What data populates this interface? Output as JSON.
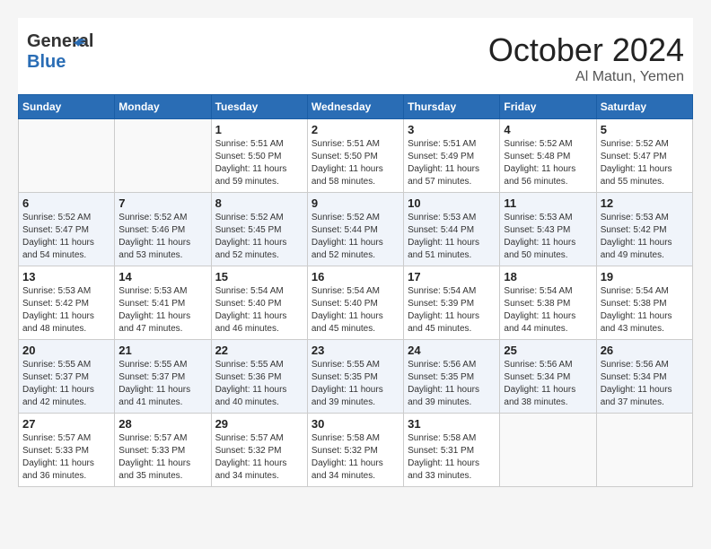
{
  "header": {
    "logo_general": "General",
    "logo_blue": "Blue",
    "month": "October 2024",
    "location": "Al Matun, Yemen"
  },
  "days_of_week": [
    "Sunday",
    "Monday",
    "Tuesday",
    "Wednesday",
    "Thursday",
    "Friday",
    "Saturday"
  ],
  "weeks": [
    [
      {
        "day": "",
        "sunrise": "",
        "sunset": "",
        "daylight": ""
      },
      {
        "day": "",
        "sunrise": "",
        "sunset": "",
        "daylight": ""
      },
      {
        "day": "1",
        "sunrise": "Sunrise: 5:51 AM",
        "sunset": "Sunset: 5:50 PM",
        "daylight": "Daylight: 11 hours and 59 minutes."
      },
      {
        "day": "2",
        "sunrise": "Sunrise: 5:51 AM",
        "sunset": "Sunset: 5:50 PM",
        "daylight": "Daylight: 11 hours and 58 minutes."
      },
      {
        "day": "3",
        "sunrise": "Sunrise: 5:51 AM",
        "sunset": "Sunset: 5:49 PM",
        "daylight": "Daylight: 11 hours and 57 minutes."
      },
      {
        "day": "4",
        "sunrise": "Sunrise: 5:52 AM",
        "sunset": "Sunset: 5:48 PM",
        "daylight": "Daylight: 11 hours and 56 minutes."
      },
      {
        "day": "5",
        "sunrise": "Sunrise: 5:52 AM",
        "sunset": "Sunset: 5:47 PM",
        "daylight": "Daylight: 11 hours and 55 minutes."
      }
    ],
    [
      {
        "day": "6",
        "sunrise": "Sunrise: 5:52 AM",
        "sunset": "Sunset: 5:47 PM",
        "daylight": "Daylight: 11 hours and 54 minutes."
      },
      {
        "day": "7",
        "sunrise": "Sunrise: 5:52 AM",
        "sunset": "Sunset: 5:46 PM",
        "daylight": "Daylight: 11 hours and 53 minutes."
      },
      {
        "day": "8",
        "sunrise": "Sunrise: 5:52 AM",
        "sunset": "Sunset: 5:45 PM",
        "daylight": "Daylight: 11 hours and 52 minutes."
      },
      {
        "day": "9",
        "sunrise": "Sunrise: 5:52 AM",
        "sunset": "Sunset: 5:44 PM",
        "daylight": "Daylight: 11 hours and 52 minutes."
      },
      {
        "day": "10",
        "sunrise": "Sunrise: 5:53 AM",
        "sunset": "Sunset: 5:44 PM",
        "daylight": "Daylight: 11 hours and 51 minutes."
      },
      {
        "day": "11",
        "sunrise": "Sunrise: 5:53 AM",
        "sunset": "Sunset: 5:43 PM",
        "daylight": "Daylight: 11 hours and 50 minutes."
      },
      {
        "day": "12",
        "sunrise": "Sunrise: 5:53 AM",
        "sunset": "Sunset: 5:42 PM",
        "daylight": "Daylight: 11 hours and 49 minutes."
      }
    ],
    [
      {
        "day": "13",
        "sunrise": "Sunrise: 5:53 AM",
        "sunset": "Sunset: 5:42 PM",
        "daylight": "Daylight: 11 hours and 48 minutes."
      },
      {
        "day": "14",
        "sunrise": "Sunrise: 5:53 AM",
        "sunset": "Sunset: 5:41 PM",
        "daylight": "Daylight: 11 hours and 47 minutes."
      },
      {
        "day": "15",
        "sunrise": "Sunrise: 5:54 AM",
        "sunset": "Sunset: 5:40 PM",
        "daylight": "Daylight: 11 hours and 46 minutes."
      },
      {
        "day": "16",
        "sunrise": "Sunrise: 5:54 AM",
        "sunset": "Sunset: 5:40 PM",
        "daylight": "Daylight: 11 hours and 45 minutes."
      },
      {
        "day": "17",
        "sunrise": "Sunrise: 5:54 AM",
        "sunset": "Sunset: 5:39 PM",
        "daylight": "Daylight: 11 hours and 45 minutes."
      },
      {
        "day": "18",
        "sunrise": "Sunrise: 5:54 AM",
        "sunset": "Sunset: 5:38 PM",
        "daylight": "Daylight: 11 hours and 44 minutes."
      },
      {
        "day": "19",
        "sunrise": "Sunrise: 5:54 AM",
        "sunset": "Sunset: 5:38 PM",
        "daylight": "Daylight: 11 hours and 43 minutes."
      }
    ],
    [
      {
        "day": "20",
        "sunrise": "Sunrise: 5:55 AM",
        "sunset": "Sunset: 5:37 PM",
        "daylight": "Daylight: 11 hours and 42 minutes."
      },
      {
        "day": "21",
        "sunrise": "Sunrise: 5:55 AM",
        "sunset": "Sunset: 5:37 PM",
        "daylight": "Daylight: 11 hours and 41 minutes."
      },
      {
        "day": "22",
        "sunrise": "Sunrise: 5:55 AM",
        "sunset": "Sunset: 5:36 PM",
        "daylight": "Daylight: 11 hours and 40 minutes."
      },
      {
        "day": "23",
        "sunrise": "Sunrise: 5:55 AM",
        "sunset": "Sunset: 5:35 PM",
        "daylight": "Daylight: 11 hours and 39 minutes."
      },
      {
        "day": "24",
        "sunrise": "Sunrise: 5:56 AM",
        "sunset": "Sunset: 5:35 PM",
        "daylight": "Daylight: 11 hours and 39 minutes."
      },
      {
        "day": "25",
        "sunrise": "Sunrise: 5:56 AM",
        "sunset": "Sunset: 5:34 PM",
        "daylight": "Daylight: 11 hours and 38 minutes."
      },
      {
        "day": "26",
        "sunrise": "Sunrise: 5:56 AM",
        "sunset": "Sunset: 5:34 PM",
        "daylight": "Daylight: 11 hours and 37 minutes."
      }
    ],
    [
      {
        "day": "27",
        "sunrise": "Sunrise: 5:57 AM",
        "sunset": "Sunset: 5:33 PM",
        "daylight": "Daylight: 11 hours and 36 minutes."
      },
      {
        "day": "28",
        "sunrise": "Sunrise: 5:57 AM",
        "sunset": "Sunset: 5:33 PM",
        "daylight": "Daylight: 11 hours and 35 minutes."
      },
      {
        "day": "29",
        "sunrise": "Sunrise: 5:57 AM",
        "sunset": "Sunset: 5:32 PM",
        "daylight": "Daylight: 11 hours and 34 minutes."
      },
      {
        "day": "30",
        "sunrise": "Sunrise: 5:58 AM",
        "sunset": "Sunset: 5:32 PM",
        "daylight": "Daylight: 11 hours and 34 minutes."
      },
      {
        "day": "31",
        "sunrise": "Sunrise: 5:58 AM",
        "sunset": "Sunset: 5:31 PM",
        "daylight": "Daylight: 11 hours and 33 minutes."
      },
      {
        "day": "",
        "sunrise": "",
        "sunset": "",
        "daylight": ""
      },
      {
        "day": "",
        "sunrise": "",
        "sunset": "",
        "daylight": ""
      }
    ]
  ]
}
